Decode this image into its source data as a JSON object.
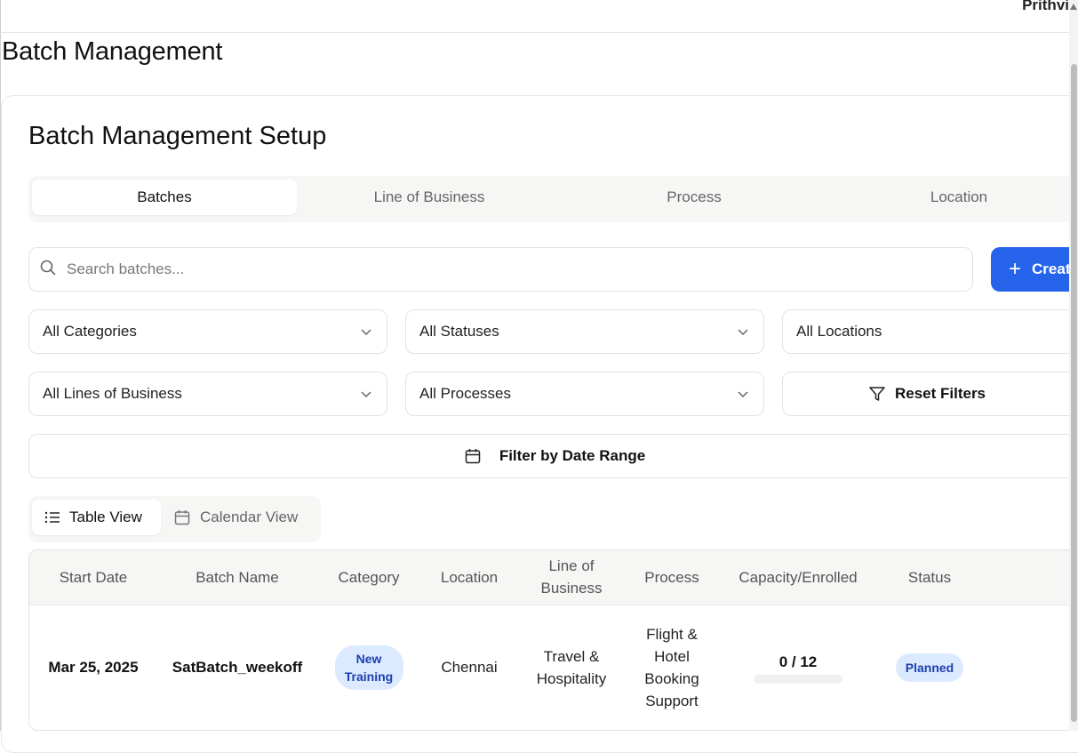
{
  "header": {
    "user_name": "Prithvi"
  },
  "page_title": "Batch Management",
  "card": {
    "title": "Batch Management Setup",
    "tabs": [
      {
        "label": "Batches",
        "active": true
      },
      {
        "label": "Line of Business",
        "active": false
      },
      {
        "label": "Process",
        "active": false
      },
      {
        "label": "Location",
        "active": false
      }
    ]
  },
  "search": {
    "placeholder": "Search batches..."
  },
  "create_button": {
    "label": "Create"
  },
  "filters": {
    "category": "All Categories",
    "status": "All Statuses",
    "location": "All Locations",
    "line_of_business": "All Lines of Business",
    "process": "All Processes",
    "reset_label": "Reset Filters",
    "date_range_label": "Filter by Date Range"
  },
  "view_toggle": {
    "table": "Table View",
    "calendar": "Calendar View",
    "active": "table"
  },
  "table": {
    "headers": {
      "start_date": "Start Date",
      "batch_name": "Batch Name",
      "category": "Category",
      "location": "Location",
      "lob_line1": "Line of",
      "lob_line2": "Business",
      "process": "Process",
      "capacity": "Capacity/Enrolled",
      "status": "Status"
    },
    "rows": [
      {
        "start_date": "Mar 25, 2025",
        "batch_name": "SatBatch_weekoff",
        "category_line1": "New",
        "category_line2": "Training",
        "location": "Chennai",
        "lob_line1": "Travel &",
        "lob_line2": "Hospitality",
        "process_lines": [
          "Flight &",
          "Hotel",
          "Booking",
          "Support"
        ],
        "capacity_text": "0 / 12",
        "enrolled_fraction": 0,
        "status": "Planned"
      }
    ]
  },
  "colors": {
    "primary": "#2563eb",
    "badge_bg": "#dbeafe",
    "badge_text": "#1e40af"
  }
}
